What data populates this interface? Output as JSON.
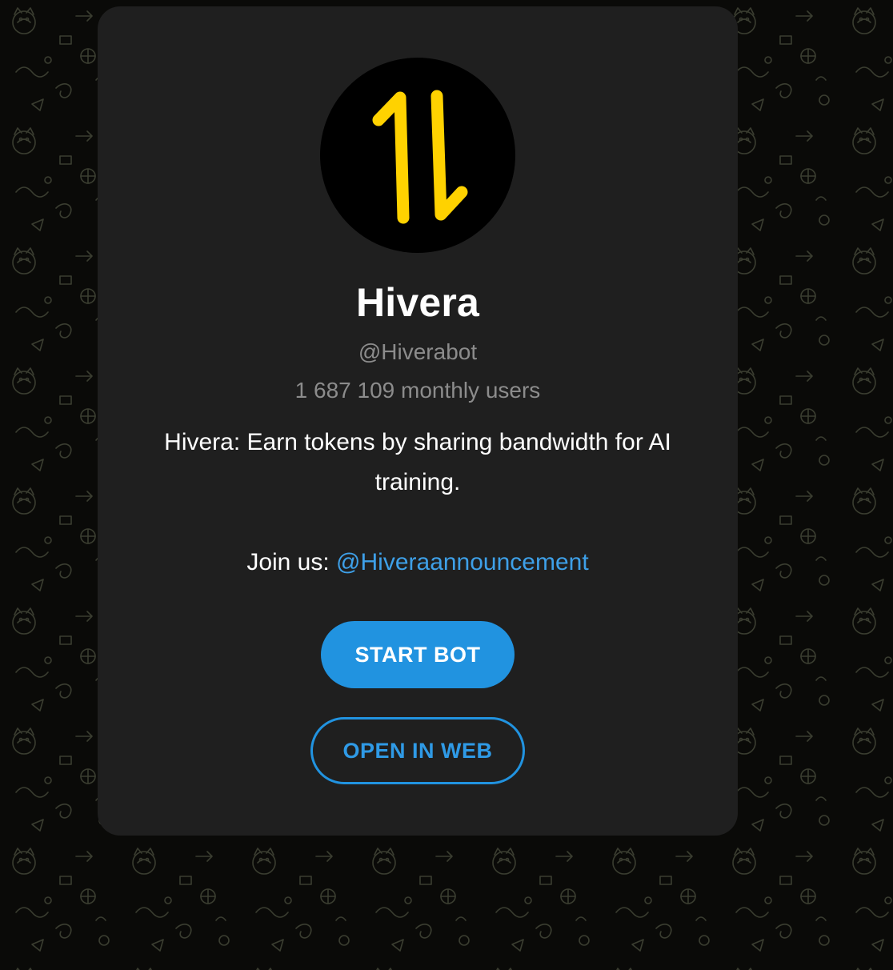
{
  "bot": {
    "name": "Hivera",
    "username": "@Hiverabot",
    "monthly_users": "1 687 109 monthly users",
    "description": "Hivera: Earn tokens by sharing bandwidth for AI training.",
    "join_prefix": "Join us: ",
    "join_link": "@Hiveraannouncement",
    "avatar_icon": "up-down-arrows-icon"
  },
  "buttons": {
    "start": "START BOT",
    "open_web": "OPEN IN WEB"
  },
  "colors": {
    "background": "#0a0a08",
    "card": "#1f1f1f",
    "accent": "#2193e0",
    "link": "#3ea0e8",
    "logo_yellow": "#ffd200",
    "muted_text": "#8c8c8c"
  }
}
